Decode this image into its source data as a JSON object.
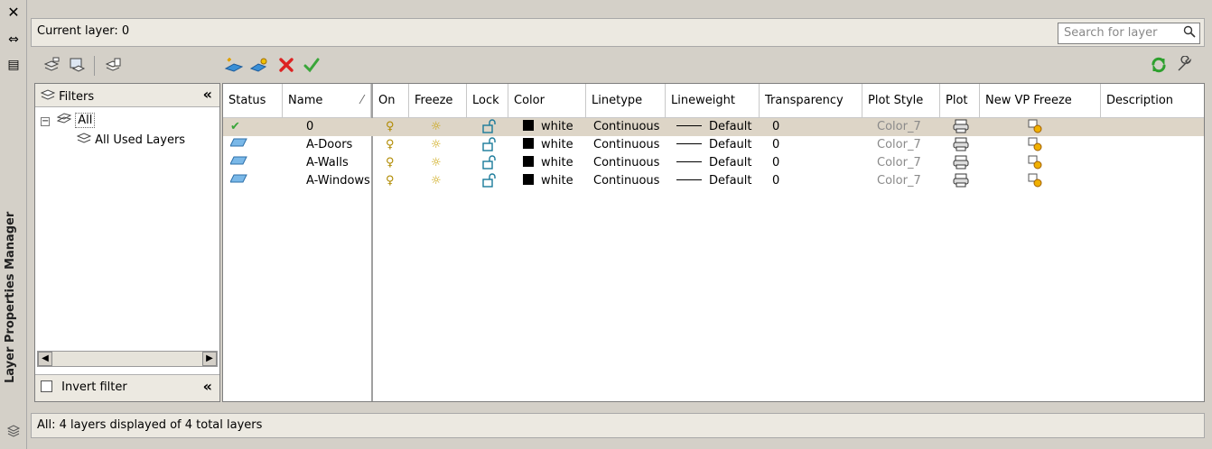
{
  "panel": {
    "title": "Layer Properties Manager",
    "close_glyph": "✕",
    "autohide_glyph": "⇔",
    "properties_glyph": "▤"
  },
  "header": {
    "current_layer": "Current layer: 0",
    "search_placeholder": "Search for layer"
  },
  "toolbar": {
    "icons": [
      "new-property-filter-icon",
      "new-group-filter-icon",
      "layer-states-manager-icon",
      "new-layer-icon",
      "new-layer-vp-frozen-icon",
      "delete-layer-icon",
      "set-current-icon",
      "refresh-icon",
      "settings-icon"
    ]
  },
  "filters": {
    "header": "Filters",
    "tree": [
      {
        "label": "All",
        "expanded": true
      },
      {
        "label": "All Used Layers"
      }
    ],
    "invert_label": "Invert filter",
    "invert_checked": false
  },
  "grid": {
    "columns": [
      "Status",
      "Name",
      "On",
      "Freeze",
      "Lock",
      "Color",
      "Linetype",
      "Lineweight",
      "Transparency",
      "Plot Style",
      "Plot",
      "New VP Freeze",
      "Description"
    ],
    "rows": [
      {
        "status": "current",
        "name": "0",
        "color": "white",
        "linetype": "Continuous",
        "lineweight": "Default",
        "transparency": "0",
        "plot_style": "Color_7",
        "selected": true
      },
      {
        "status": "layer",
        "name": "A-Doors",
        "color": "white",
        "linetype": "Continuous",
        "lineweight": "Default",
        "transparency": "0",
        "plot_style": "Color_7",
        "selected": false
      },
      {
        "status": "layer",
        "name": "A-Walls",
        "color": "white",
        "linetype": "Continuous",
        "lineweight": "Default",
        "transparency": "0",
        "plot_style": "Color_7",
        "selected": false
      },
      {
        "status": "layer",
        "name": "A-Windows",
        "color": "white",
        "linetype": "Continuous",
        "lineweight": "Default",
        "transparency": "0",
        "plot_style": "Color_7",
        "selected": false
      }
    ]
  },
  "status_bar": {
    "text": "All: 4 layers displayed of 4 total layers"
  },
  "colors": {
    "selected_row": "#ddd5c7",
    "status_check": "#3aa63a"
  }
}
